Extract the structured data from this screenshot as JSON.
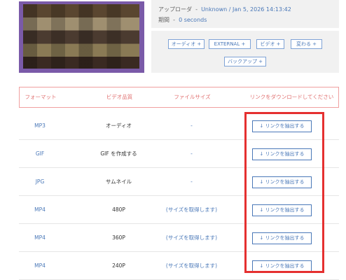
{
  "meta": {
    "uploader_label": "アップローダ",
    "uploader_value": "Unknown / Jan 5, 2026 14:13:42",
    "duration_label": "期間",
    "duration_value": "0 seconds"
  },
  "format_buttons": [
    "オーディオ +",
    "EXTERNAL +",
    "ビデオ +",
    "変わる +",
    "バックアップ +"
  ],
  "table": {
    "headers": [
      "フォーマット",
      "ビデオ品質",
      "ファイルサイズ",
      "リンクをダウンロードしてください"
    ],
    "rows": [
      {
        "format": "MP3",
        "quality": "オーディオ",
        "size": "-",
        "action": "↓ リンクを抽出する"
      },
      {
        "format": "GIF",
        "quality": "GIF を作成する",
        "size": "-",
        "action": "↓ リンクを抽出する"
      },
      {
        "format": "JPG",
        "quality": "サムネイル",
        "size": "-",
        "action": "↓ リンクを抽出する"
      },
      {
        "format": "MP4",
        "quality": "480P",
        "size": "(サイズを取得します)",
        "action": "↓ リンクを抽出する"
      },
      {
        "format": "MP4",
        "quality": "360P",
        "size": "(サイズを取得します)",
        "action": "↓ リンクを抽出する"
      },
      {
        "format": "MP4",
        "quality": "240P",
        "size": "(サイズを取得します)",
        "action": "↓ リンクを抽出する"
      }
    ]
  },
  "colors": {
    "accent": "#4a78b8",
    "header_text": "#e07070",
    "highlight": "#e53030",
    "thumb_border": "#7a5aa8"
  }
}
